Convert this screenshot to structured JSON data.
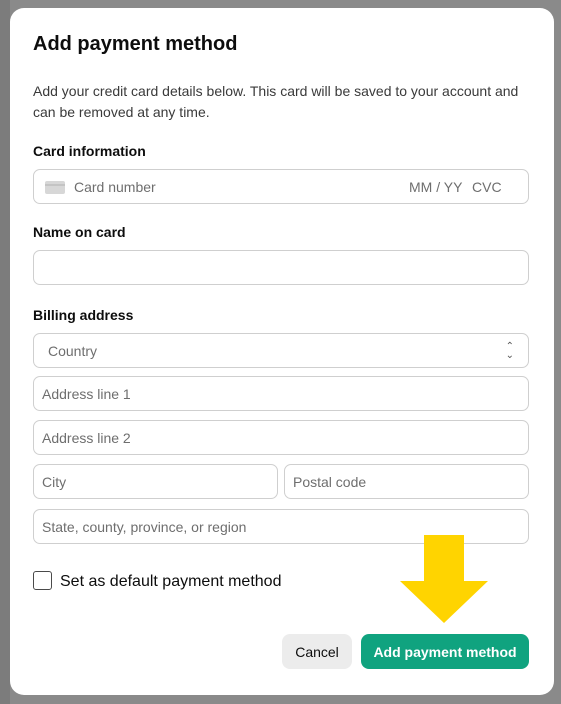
{
  "modal": {
    "title": "Add payment method",
    "description": "Add your credit card details below. This card will be saved to your account and can be removed at any time."
  },
  "card": {
    "label": "Card information",
    "number_placeholder": "Card number",
    "expiry_placeholder": "MM / YY",
    "cvc_placeholder": "CVC"
  },
  "name": {
    "label": "Name on card",
    "value": ""
  },
  "billing": {
    "label": "Billing address",
    "country_placeholder": "Country",
    "address1_placeholder": "Address line 1",
    "address2_placeholder": "Address line 2",
    "city_placeholder": "City",
    "postal_placeholder": "Postal code",
    "state_placeholder": "State, county, province, or region"
  },
  "default_checkbox": {
    "label": "Set as default payment method",
    "checked": false
  },
  "actions": {
    "cancel_label": "Cancel",
    "submit_label": "Add payment method"
  },
  "colors": {
    "primary": "#10a37f",
    "annotation_arrow": "#ffd400"
  },
  "icons": {
    "card": "credit-card-icon",
    "chevron": "chevron-up-down-icon",
    "arrow": "arrow-down-icon"
  }
}
